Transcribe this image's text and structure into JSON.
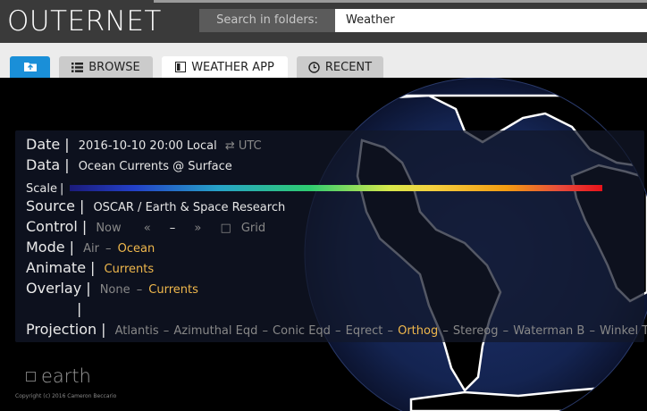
{
  "app": {
    "title": "OUTERNET"
  },
  "search": {
    "label": "Search in folders:",
    "value": "Weather"
  },
  "tabs": {
    "folder_icon": "folder-icon",
    "browse": "BROWSE",
    "weather": "WEATHER APP",
    "recent": "RECENT"
  },
  "panel": {
    "date": {
      "label": "Date",
      "value": "2016-10-10 20:00 Local",
      "toggle": "⇄ UTC"
    },
    "data": {
      "label": "Data",
      "value": "Ocean Currents @ Surface"
    },
    "scale": {
      "label": "Scale"
    },
    "source": {
      "label": "Source",
      "value": "OSCAR / Earth & Space Research"
    },
    "control": {
      "label": "Control",
      "now": "Now",
      "prev": "«",
      "dash": "–",
      "next": "»",
      "grid_box": "□",
      "grid": "Grid"
    },
    "mode": {
      "label": "Mode",
      "air": "Air",
      "dash": "–",
      "ocean": "Ocean"
    },
    "animate": {
      "label": "Animate",
      "value": "Currents"
    },
    "overlay": {
      "label": "Overlay",
      "none": "None",
      "dash": "–",
      "currents": "Currents"
    },
    "projection": {
      "label": "Projection",
      "items": [
        "Atlantis",
        "–",
        "Azimuthal Eqd",
        "–",
        "Conic Eqd",
        "–",
        "Eqrect",
        "–",
        "Orthog",
        "–",
        "Stereog",
        "–",
        "Waterman B",
        "–",
        "Winkel T"
      ]
    }
  },
  "footer": {
    "brand": "earth",
    "brand_box": "□",
    "copyright": "Copyright (c) 2016 Cameron Beccario"
  },
  "colors": {
    "accent": "#1a8fd8",
    "highlight": "#f0b84c",
    "background": "#000000"
  }
}
